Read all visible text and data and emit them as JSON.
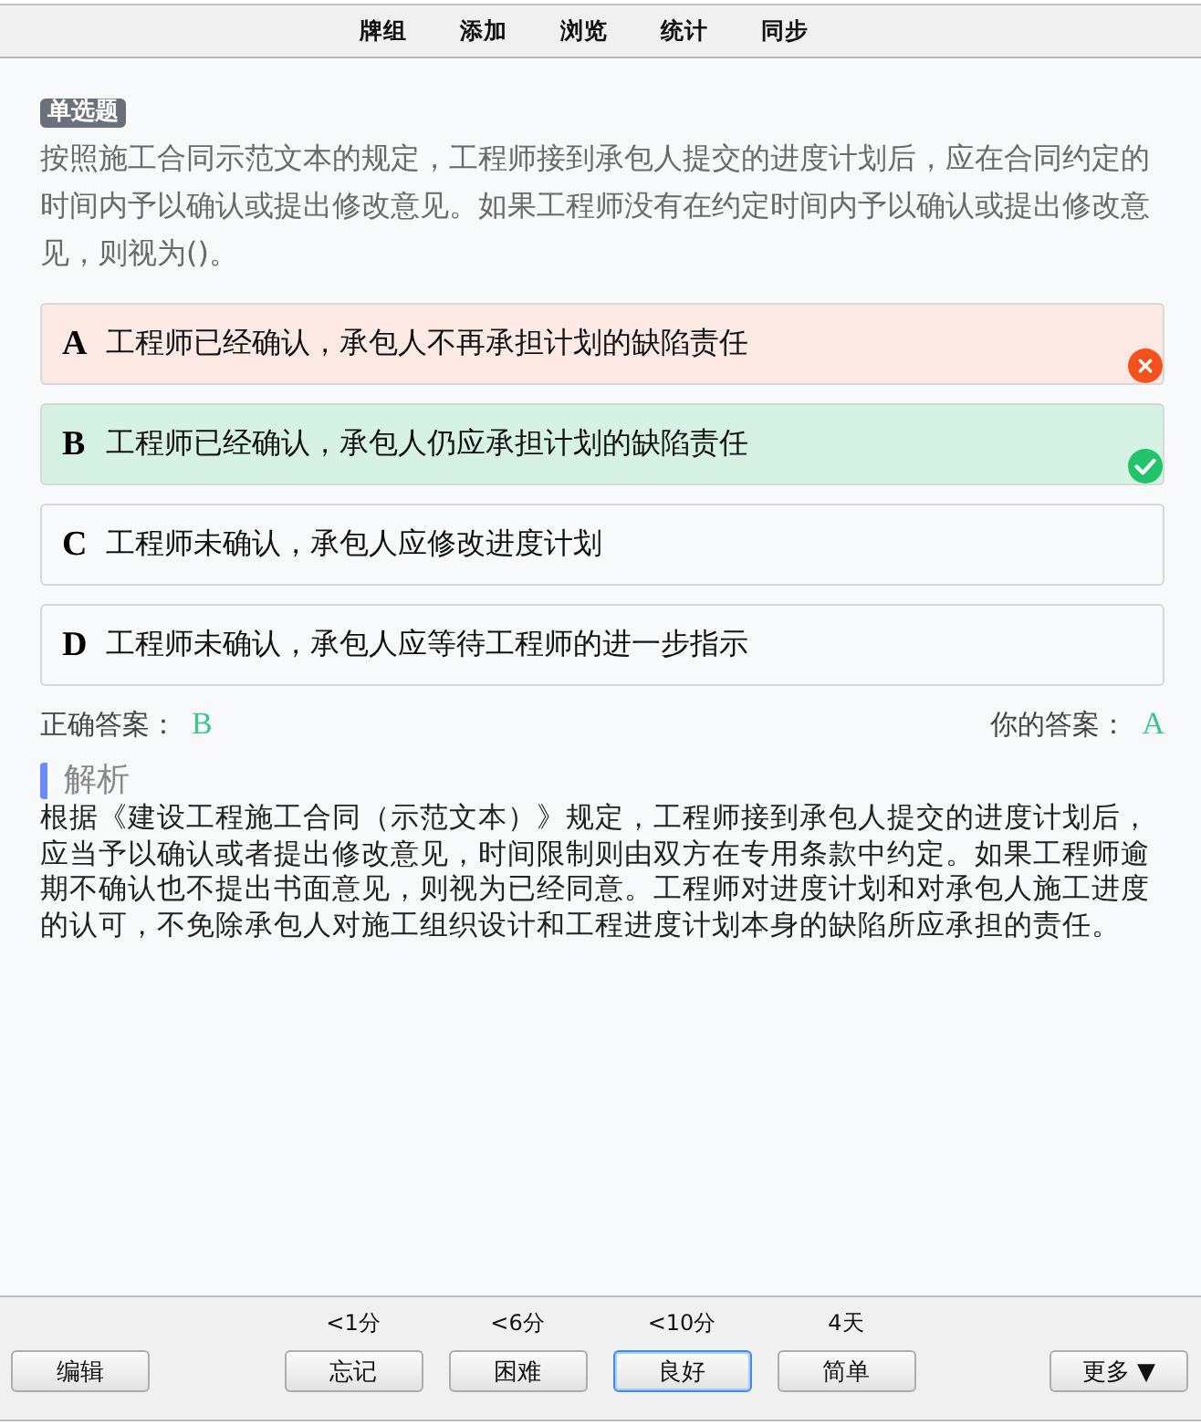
{
  "nav": [
    "牌组",
    "添加",
    "浏览",
    "统计",
    "同步"
  ],
  "question": {
    "type_tag": "单选题",
    "text": "按照施工合同示范文本的规定，工程师接到承包人提交的进度计划后，应在合同约定的时间内予以确认或提出修改意见。如果工程师没有在约定时间内予以确认或提出修改意见，则视为()。"
  },
  "options": [
    {
      "letter": "A",
      "text": "工程师已经确认，承包人不再承担计划的缺陷责任",
      "kind": "wrong"
    },
    {
      "letter": "B",
      "text": "工程师已经确认，承包人仍应承担计划的缺陷责任",
      "kind": "correct"
    },
    {
      "letter": "C",
      "text": "工程师未确认，承包人应修改进度计划",
      "kind": "plain"
    },
    {
      "letter": "D",
      "text": "工程师未确认，承包人应等待工程师的进一步指示",
      "kind": "plain"
    }
  ],
  "answer_row": {
    "correct_label": "正确答案：",
    "correct_value": "B",
    "your_label": "你的答案：",
    "your_value": "A"
  },
  "analysis": {
    "heading": "解析",
    "text": "根据《建设工程施工合同（示范文本）》规定，工程师接到承包人提交的进度计划后，应当予以确认或者提出修改意见，时间限制则由双方在专用条款中约定。如果工程师逾期不确认也不提出书面意见，则视为已经同意。工程师对进度计划和对承包人施工进度的认可，不免除承包人对施工组织设计和工程进度计划本身的缺陷所应承担的责任。"
  },
  "bottom_bar": {
    "edit_button": "编辑",
    "ease_buttons": [
      {
        "interval": "<1分",
        "label": "忘记",
        "focused": false
      },
      {
        "interval": "<6分",
        "label": "困难",
        "focused": false
      },
      {
        "interval": "<10分",
        "label": "良好",
        "focused": true
      },
      {
        "interval": "4天",
        "label": "简单",
        "focused": false
      }
    ],
    "more_button": "更多 ▼"
  }
}
